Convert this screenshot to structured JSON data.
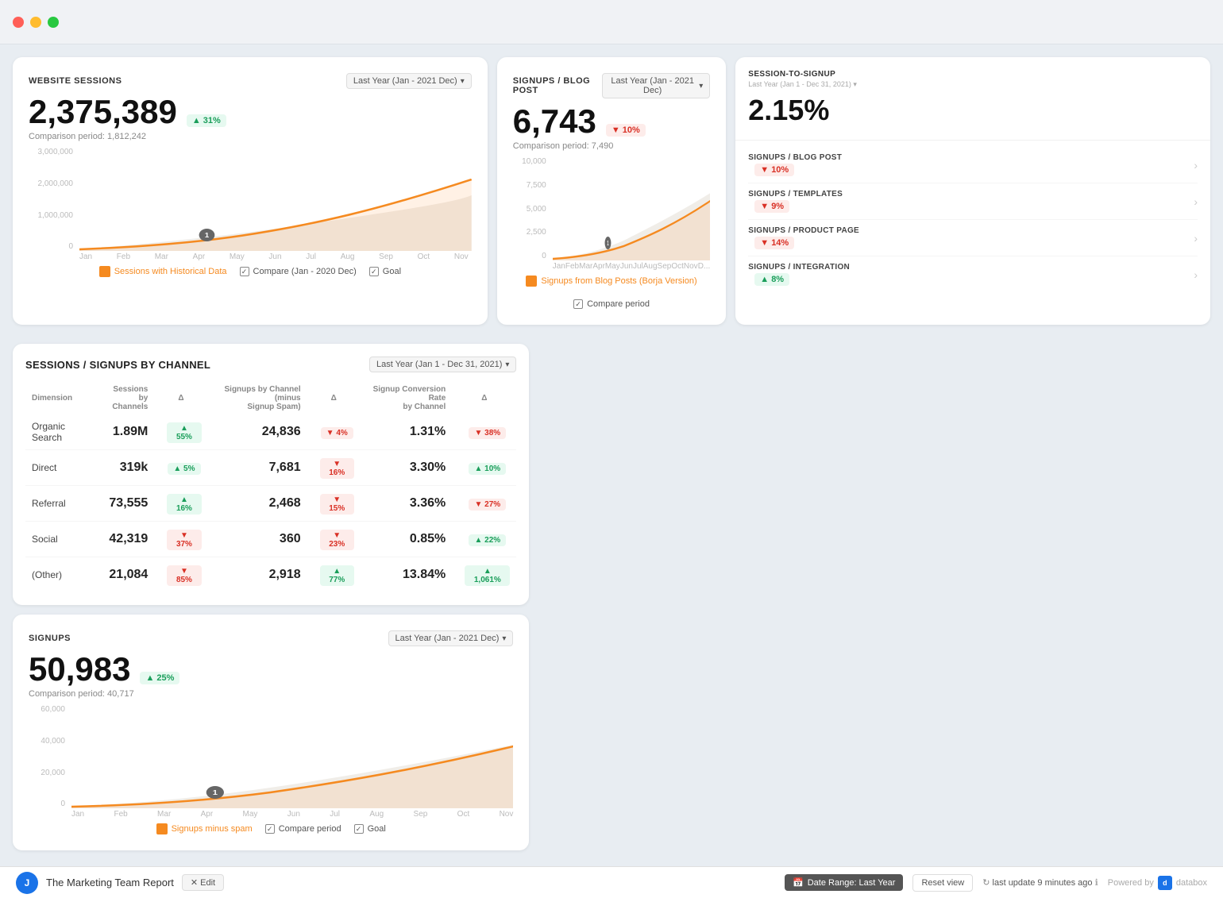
{
  "titlebar": {
    "buttons": [
      "close",
      "minimize",
      "maximize"
    ]
  },
  "websiteSessions": {
    "title": "WEBSITE SESSIONS",
    "dropdown": "Last Year (Jan - 2021 Dec)",
    "value": "2,375,389",
    "badge": "▲ 31%",
    "badge_type": "green",
    "comparison": "Comparison period: 1,812,242",
    "chart": {
      "y_labels": [
        "3,000,000",
        "2,000,000",
        "1,000,000",
        "0"
      ],
      "x_labels": [
        "Jan",
        "Feb",
        "Mar",
        "Apr",
        "May",
        "Jun",
        "Jul",
        "Aug",
        "Sep",
        "Oct",
        "Nov"
      ]
    },
    "legend": [
      {
        "label": "Sessions with Historical Data",
        "type": "checkbox-orange"
      },
      {
        "label": "Compare (Jan - 2020 Dec)",
        "type": "checkbox"
      },
      {
        "label": "Goal",
        "type": "checkbox"
      }
    ]
  },
  "sessionToSignup": {
    "label": "SESSION-TO-SIGNUP",
    "sub": "Last Year (Jan 1 - Dec 31, 2021) ▾",
    "value": "2.15%"
  },
  "signupsList": [
    {
      "name": "SIGNUPS / BLOG POST",
      "badge": "▼ 10%",
      "badge_type": "red"
    },
    {
      "name": "SIGNUPS / TEMPLATES",
      "badge": "▼ 9%",
      "badge_type": "red"
    },
    {
      "name": "SIGNUPS / PRODUCT PAGE",
      "badge": "▼ 14%",
      "badge_type": "red"
    },
    {
      "name": "SIGNUPS / INTEGRATION",
      "badge": "▲ 8%",
      "badge_type": "green"
    }
  ],
  "blogPost": {
    "title": "SIGNUPS / BLOG POST",
    "dropdown": "Last Year (Jan - 2021 Dec)",
    "value": "6,743",
    "badge": "▼ 10%",
    "badge_type": "red",
    "comparison": "Comparison period: 7,490",
    "chart": {
      "y_labels": [
        "10,000",
        "7,500",
        "5,000",
        "2,500",
        "0"
      ],
      "x_labels": [
        "Jan",
        "Feb",
        "Mar",
        "Apr",
        "May",
        "Jun",
        "Jul",
        "Aug",
        "Sep",
        "Oct",
        "Nov",
        "D..."
      ]
    },
    "legend": [
      {
        "label": "Signups from Blog Posts (Borja Version)",
        "type": "checkbox-orange"
      },
      {
        "label": "Compare period",
        "type": "checkbox"
      }
    ]
  },
  "signups": {
    "title": "SIGNUPS",
    "dropdown": "Last Year (Jan - 2021 Dec)",
    "value": "50,983",
    "badge": "▲ 25%",
    "badge_type": "green",
    "comparison": "Comparison period: 40,717",
    "chart": {
      "y_labels": [
        "60,000",
        "40,000",
        "20,000",
        "0"
      ],
      "x_labels": [
        "Jan",
        "Feb",
        "Mar",
        "Apr",
        "May",
        "Jun",
        "Jul",
        "Aug",
        "Sep",
        "Oct",
        "Nov"
      ]
    },
    "legend": [
      {
        "label": "Signups minus spam",
        "type": "checkbox-orange"
      },
      {
        "label": "Compare period",
        "type": "checkbox"
      },
      {
        "label": "Goal",
        "type": "checkbox"
      }
    ]
  },
  "channels": {
    "title": "SESSIONS / SIGNUPS BY CHANNEL",
    "dropdown": "Last Year (Jan 1 - Dec 31, 2021)",
    "headers": {
      "dimension": "Dimension",
      "sessions": "Sessions by\nChannels",
      "sessions_delta": "Δ",
      "signups": "Signups by Channel (minus\nSignup Spam)",
      "signups_delta": "Δ",
      "rate": "Signup Conversion Rate\nby Channel",
      "rate_delta": "Δ"
    },
    "rows": [
      {
        "dimension": "Organic Search",
        "sessions": "1.89M",
        "sessions_delta": "▲ 55%",
        "sessions_delta_type": "green",
        "signups": "24,836",
        "signups_delta": "▼ 4%",
        "signups_delta_type": "red",
        "rate": "1.31%",
        "rate_delta": "▼ 38%",
        "rate_delta_type": "red"
      },
      {
        "dimension": "Direct",
        "sessions": "319k",
        "sessions_delta": "▲ 5%",
        "sessions_delta_type": "green",
        "signups": "7,681",
        "signups_delta": "▼ 16%",
        "signups_delta_type": "red",
        "rate": "3.30%",
        "rate_delta": "▲ 10%",
        "rate_delta_type": "green"
      },
      {
        "dimension": "Referral",
        "sessions": "73,555",
        "sessions_delta": "▲ 16%",
        "sessions_delta_type": "green",
        "signups": "2,468",
        "signups_delta": "▼ 15%",
        "signups_delta_type": "red",
        "rate": "3.36%",
        "rate_delta": "▼ 27%",
        "rate_delta_type": "red"
      },
      {
        "dimension": "Social",
        "sessions": "42,319",
        "sessions_delta": "▼ 37%",
        "sessions_delta_type": "red",
        "signups": "360",
        "signups_delta": "▼ 23%",
        "signups_delta_type": "red",
        "rate": "0.85%",
        "rate_delta": "▲ 22%",
        "rate_delta_type": "green"
      },
      {
        "dimension": "(Other)",
        "sessions": "21,084",
        "sessions_delta": "▼ 85%",
        "sessions_delta_type": "red",
        "signups": "2,918",
        "signups_delta": "▲ 77%",
        "signups_delta_type": "green",
        "rate": "13.84%",
        "rate_delta": "▲ 1,061%",
        "rate_delta_type": "green"
      }
    ]
  },
  "footer": {
    "title": "The Marketing Team Report",
    "edit_label": "✕ Edit",
    "date_range_label": "Date Range: Last Year",
    "reset_label": "Reset view",
    "last_update": "last update 9 minutes ago",
    "powered_by": "Powered by",
    "databox": "databox"
  }
}
